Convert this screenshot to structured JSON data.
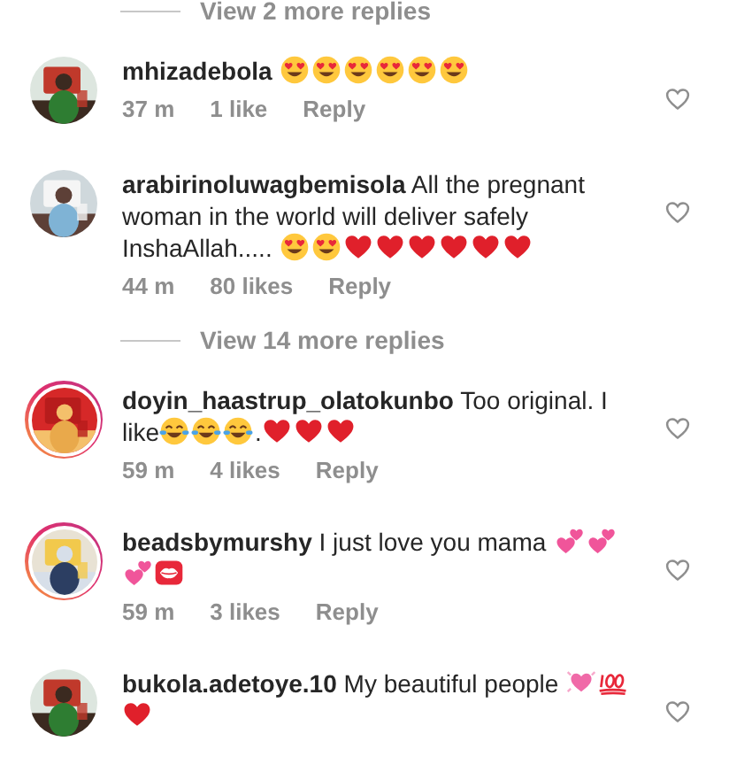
{
  "items": [
    {
      "kind": "view_replies",
      "label": "View 2 more replies"
    },
    {
      "kind": "comment",
      "username": "mhizadebola",
      "story_ring": false,
      "liked": false,
      "body": [
        {
          "kind": "heart-eyes"
        },
        {
          "kind": "heart-eyes"
        },
        {
          "kind": "heart-eyes"
        },
        {
          "kind": "heart-eyes"
        },
        {
          "kind": "heart-eyes"
        },
        {
          "kind": "heart-eyes"
        }
      ],
      "time": "37 m",
      "likes": "1 like",
      "reply": "Reply"
    },
    {
      "kind": "comment",
      "username": "arabirinoluwagbemisola",
      "story_ring": false,
      "liked": false,
      "body": [
        {
          "kind": "text",
          "text": "All the pregnant woman in the world will deliver safely InshaAllah..... "
        },
        {
          "kind": "heart-eyes"
        },
        {
          "kind": "heart-eyes"
        },
        {
          "kind": "red-heart"
        },
        {
          "kind": "red-heart"
        },
        {
          "kind": "red-heart"
        },
        {
          "kind": "red-heart"
        },
        {
          "kind": "red-heart"
        },
        {
          "kind": "red-heart"
        }
      ],
      "time": "44 m",
      "likes": "80 likes",
      "reply": "Reply"
    },
    {
      "kind": "view_replies",
      "label": "View 14 more replies"
    },
    {
      "kind": "comment",
      "username": "doyin_haastrup_olatokunbo",
      "story_ring": true,
      "liked": false,
      "body": [
        {
          "kind": "text",
          "text": "Too original. I like"
        },
        {
          "kind": "joy"
        },
        {
          "kind": "joy"
        },
        {
          "kind": "joy"
        },
        {
          "kind": "text",
          "text": "."
        },
        {
          "kind": "red-heart"
        },
        {
          "kind": "red-heart"
        },
        {
          "kind": "red-heart"
        }
      ],
      "time": "59 m",
      "likes": "4 likes",
      "reply": "Reply"
    },
    {
      "kind": "comment",
      "username": "beadsbymurshy",
      "story_ring": true,
      "liked": false,
      "body": [
        {
          "kind": "text",
          "text": "I just love you mama "
        },
        {
          "kind": "two-hearts"
        },
        {
          "kind": "two-hearts"
        },
        {
          "kind": "two-hearts"
        },
        {
          "kind": "kiss"
        }
      ],
      "time": "59 m",
      "likes": "3 likes",
      "reply": "Reply"
    },
    {
      "kind": "comment",
      "username": "bukola.adetoye.10",
      "story_ring": false,
      "liked": false,
      "body": [
        {
          "kind": "text",
          "text": "My beautiful people "
        },
        {
          "kind": "growing-heart"
        },
        {
          "kind": "hundred"
        },
        {
          "kind": "red-heart"
        }
      ]
    }
  ]
}
